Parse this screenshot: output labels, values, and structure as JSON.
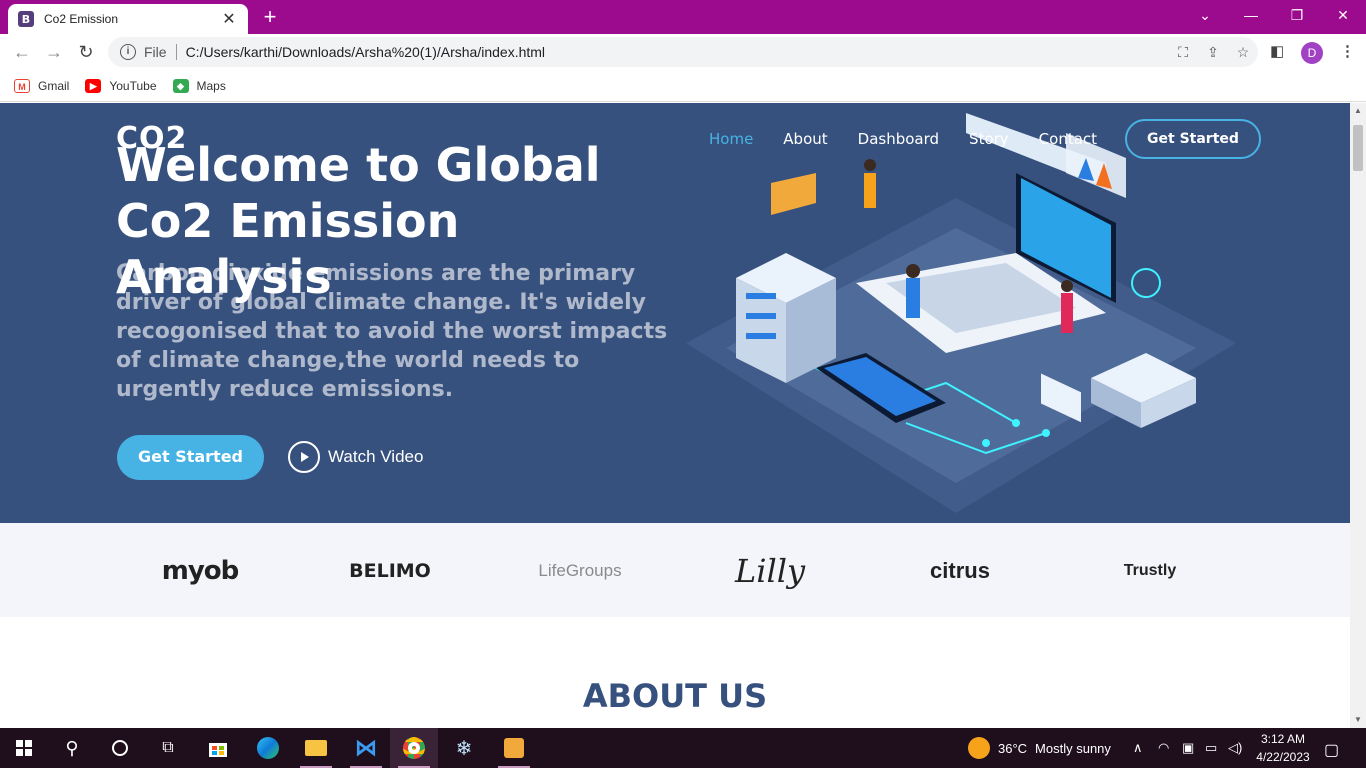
{
  "browser": {
    "tab_title": "Co2 Emission",
    "tab_favicon": "B",
    "url_scheme": "File",
    "url": "C:/Users/karthi/Downloads/Arsha%20(1)/Arsha/index.html",
    "profile_initial": "D"
  },
  "bookmarks": [
    {
      "label": "Gmail",
      "icon": "gmail-icon",
      "color": "#ea4335"
    },
    {
      "label": "YouTube",
      "icon": "youtube-icon",
      "color": "#ff0000"
    },
    {
      "label": "Maps",
      "icon": "maps-icon",
      "color": "#34a853"
    }
  ],
  "site": {
    "logo": "CO2",
    "nav": [
      "Home",
      "About",
      "Dashboard",
      "Story",
      "Contact"
    ],
    "nav_cta": "Get Started",
    "accent_color": "#47b2e4",
    "hero_color": "#37517e"
  },
  "hero": {
    "title": "Welcome to Global Co2 Emission Analysis",
    "subtitle": "Carbon dioxide emissions are the primary driver of global climate change. It's widely recogonised that to avoid the worst impacts of climate change,the world needs to urgently reduce emissions.",
    "cta_primary": "Get Started",
    "cta_video": "Watch Video"
  },
  "clients": [
    "myob",
    "BELIMO",
    "LifeGroups",
    "Lilly",
    "citrus",
    "Trustly"
  ],
  "about": {
    "title": "ABOUT US"
  },
  "taskbar": {
    "weather_temp": "36°C",
    "weather_desc": "Mostly sunny",
    "time": "3:12 AM",
    "date": "4/22/2023"
  }
}
